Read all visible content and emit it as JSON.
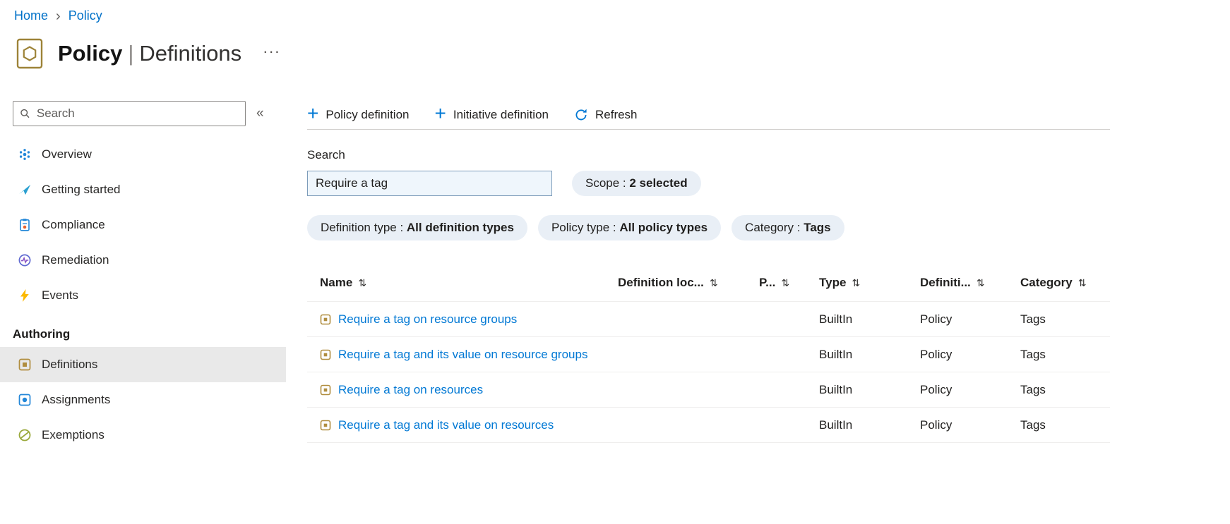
{
  "colors": {
    "accent": "#0078d4",
    "link": "#0078d4",
    "pill_background": "#e9eff6",
    "search_background": "#eff6fc",
    "selected_item_background": "#e9e9e9",
    "policy_icon": "#9d8338",
    "events_icon": "#fcb900"
  },
  "icons": {
    "breadcrumb_chevron": "›",
    "plus": "+",
    "collapse": "«",
    "more": "···",
    "sort": "⇅"
  },
  "breadcrumb": {
    "items": [
      {
        "label": "Home"
      },
      {
        "label": "Policy"
      }
    ]
  },
  "header": {
    "title_primary": "Policy",
    "title_separator": "|",
    "title_secondary": "Definitions"
  },
  "sidebar": {
    "search_placeholder": "Search",
    "items": [
      {
        "label": "Overview"
      },
      {
        "label": "Getting started"
      },
      {
        "label": "Compliance"
      },
      {
        "label": "Remediation"
      },
      {
        "label": "Events"
      }
    ],
    "section_label": "Authoring",
    "authoring_items": [
      {
        "label": "Definitions",
        "selected": true
      },
      {
        "label": "Assignments",
        "selected": false
      },
      {
        "label": "Exemptions",
        "selected": false
      }
    ]
  },
  "commandbar": {
    "items": [
      {
        "label": "Policy definition"
      },
      {
        "label": "Initiative definition"
      },
      {
        "label": "Refresh"
      }
    ]
  },
  "filters": {
    "search_label": "Search",
    "search_value": "Require a tag",
    "separator": " : ",
    "pills": [
      {
        "name": "Scope",
        "value": "2 selected"
      },
      {
        "name": "Definition type",
        "value": "All definition types"
      },
      {
        "name": "Policy type",
        "value": "All policy types"
      },
      {
        "name": "Category",
        "value": "Tags"
      }
    ]
  },
  "table": {
    "columns": [
      "Name",
      "Definition loc...",
      "P...",
      "Type",
      "Definiti...",
      "Category"
    ],
    "rows": [
      {
        "name": "Require a tag on resource groups",
        "type": "BuiltIn",
        "definition_type": "Policy",
        "category": "Tags"
      },
      {
        "name": "Require a tag and its value on resource groups",
        "type": "BuiltIn",
        "definition_type": "Policy",
        "category": "Tags"
      },
      {
        "name": "Require a tag on resources",
        "type": "BuiltIn",
        "definition_type": "Policy",
        "category": "Tags"
      },
      {
        "name": "Require a tag and its value on resources",
        "type": "BuiltIn",
        "definition_type": "Policy",
        "category": "Tags"
      }
    ]
  }
}
